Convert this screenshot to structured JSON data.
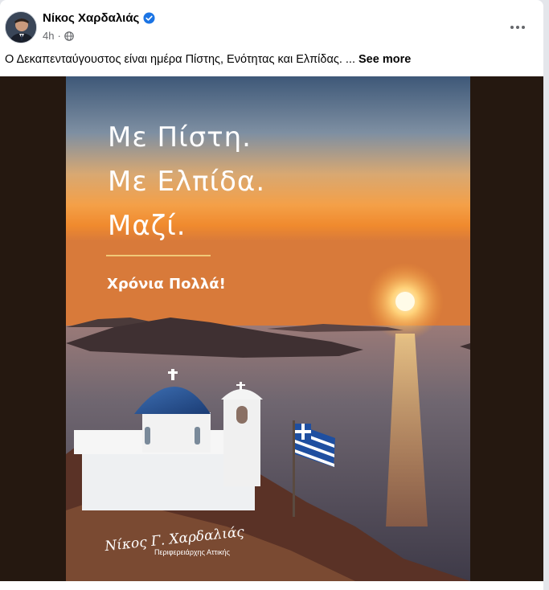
{
  "post": {
    "author": "Νίκος Χαρδαλιάς",
    "time": "4h",
    "caption": "Ο Δεκαπενταύγουστος είναι ημέρα Πίστης, Ενότητας και Ελπίδας. ...",
    "see_more": "See more",
    "icons": {
      "verified": "verified-badge-icon",
      "audience": "globe-icon",
      "more": "more-options-icon"
    }
  },
  "poster": {
    "line1": "Με Πίστη.",
    "line2": "Με Ελπίδα.",
    "line3": "Μαζί.",
    "wish": "Χρόνια Πολλά!",
    "signature": "Νίκος Γ. Χαρδαλιάς",
    "signature_title": "Περιφερειάρχης Αττικής"
  },
  "colors": {
    "verified_blue": "#1b74e4",
    "rule_gold": "#f1c978",
    "media_bg": "#251810"
  }
}
